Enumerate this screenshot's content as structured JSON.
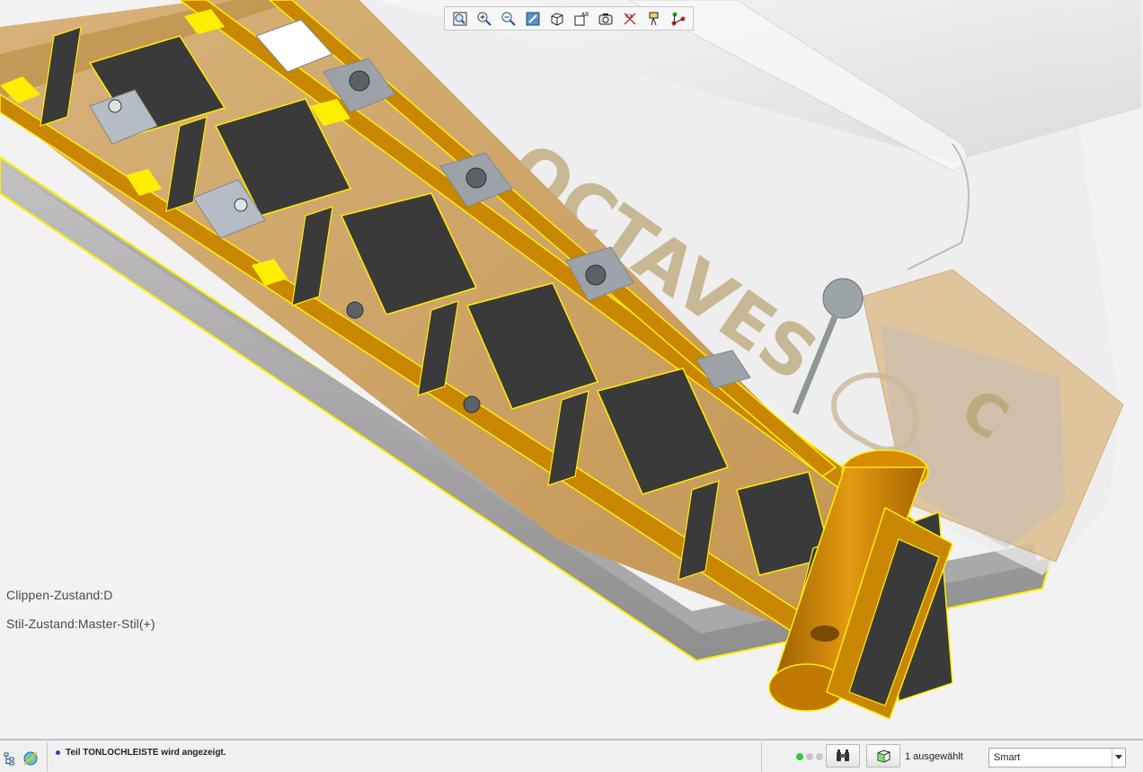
{
  "view_toolbar": {
    "buttons": [
      {
        "name": "refit-button",
        "icon": "refit-icon"
      },
      {
        "name": "zoom-in-button",
        "icon": "zoom-in-icon"
      },
      {
        "name": "zoom-out-button",
        "icon": "zoom-out-icon"
      },
      {
        "name": "repaint-button",
        "icon": "repaint-icon"
      },
      {
        "name": "display-style-button",
        "icon": "display-style-icon"
      },
      {
        "name": "saved-orientations-button",
        "icon": "saved-orientations-icon"
      },
      {
        "name": "view-manager-button",
        "icon": "view-manager-icon"
      },
      {
        "name": "datum-display-button",
        "icon": "datum-display-icon"
      },
      {
        "name": "annotation-display-button",
        "icon": "annotation-display-icon"
      },
      {
        "name": "spin-center-button",
        "icon": "spin-center-icon"
      }
    ]
  },
  "model": {
    "embossed_text": "OCTAVES",
    "embossed_text_2": "C",
    "highlight_color": "#ffee00",
    "section_color": "#c98600",
    "cut_face_color": "#3a3a3a"
  },
  "overlay": {
    "clip_state": "Clippen-Zustand:D",
    "style_state": "Stil-Zustand:Master-Stil(+)"
  },
  "statusbar": {
    "message": "Teil TONLOCHLEISTE wird angezeigt.",
    "selection_count": "1 ausgewählt",
    "filter_value": "Smart",
    "led_colors": [
      "#2ecc40",
      "#c8c8c8",
      "#c8c8c8"
    ]
  }
}
